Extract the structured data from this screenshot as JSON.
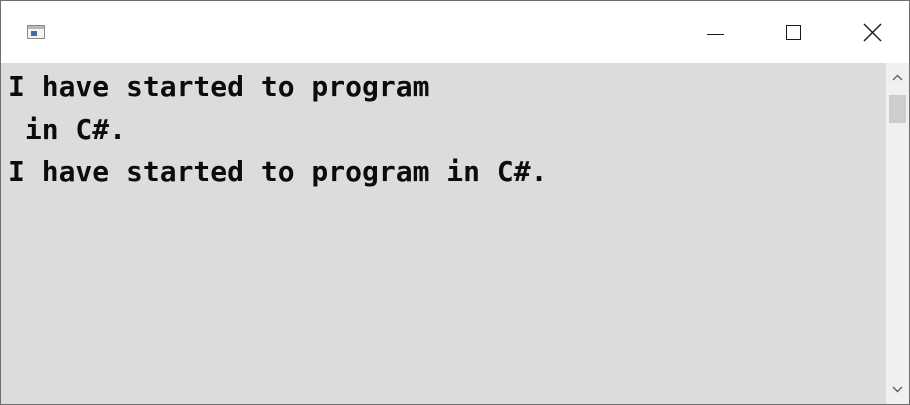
{
  "window": {
    "icons": {
      "app": "console-app-icon",
      "minimize": "minimize-icon",
      "maximize": "maximize-icon",
      "close": "close-icon"
    }
  },
  "console": {
    "lines": [
      "I have started to program",
      " in C#.",
      "I have started to program in C#."
    ],
    "colors": {
      "background": "#dcdcdc",
      "text": "#0c0c0c"
    }
  },
  "scrollbar": {
    "up_icon": "chevron-up-icon",
    "down_icon": "chevron-down-icon",
    "scroll_position": 0
  }
}
